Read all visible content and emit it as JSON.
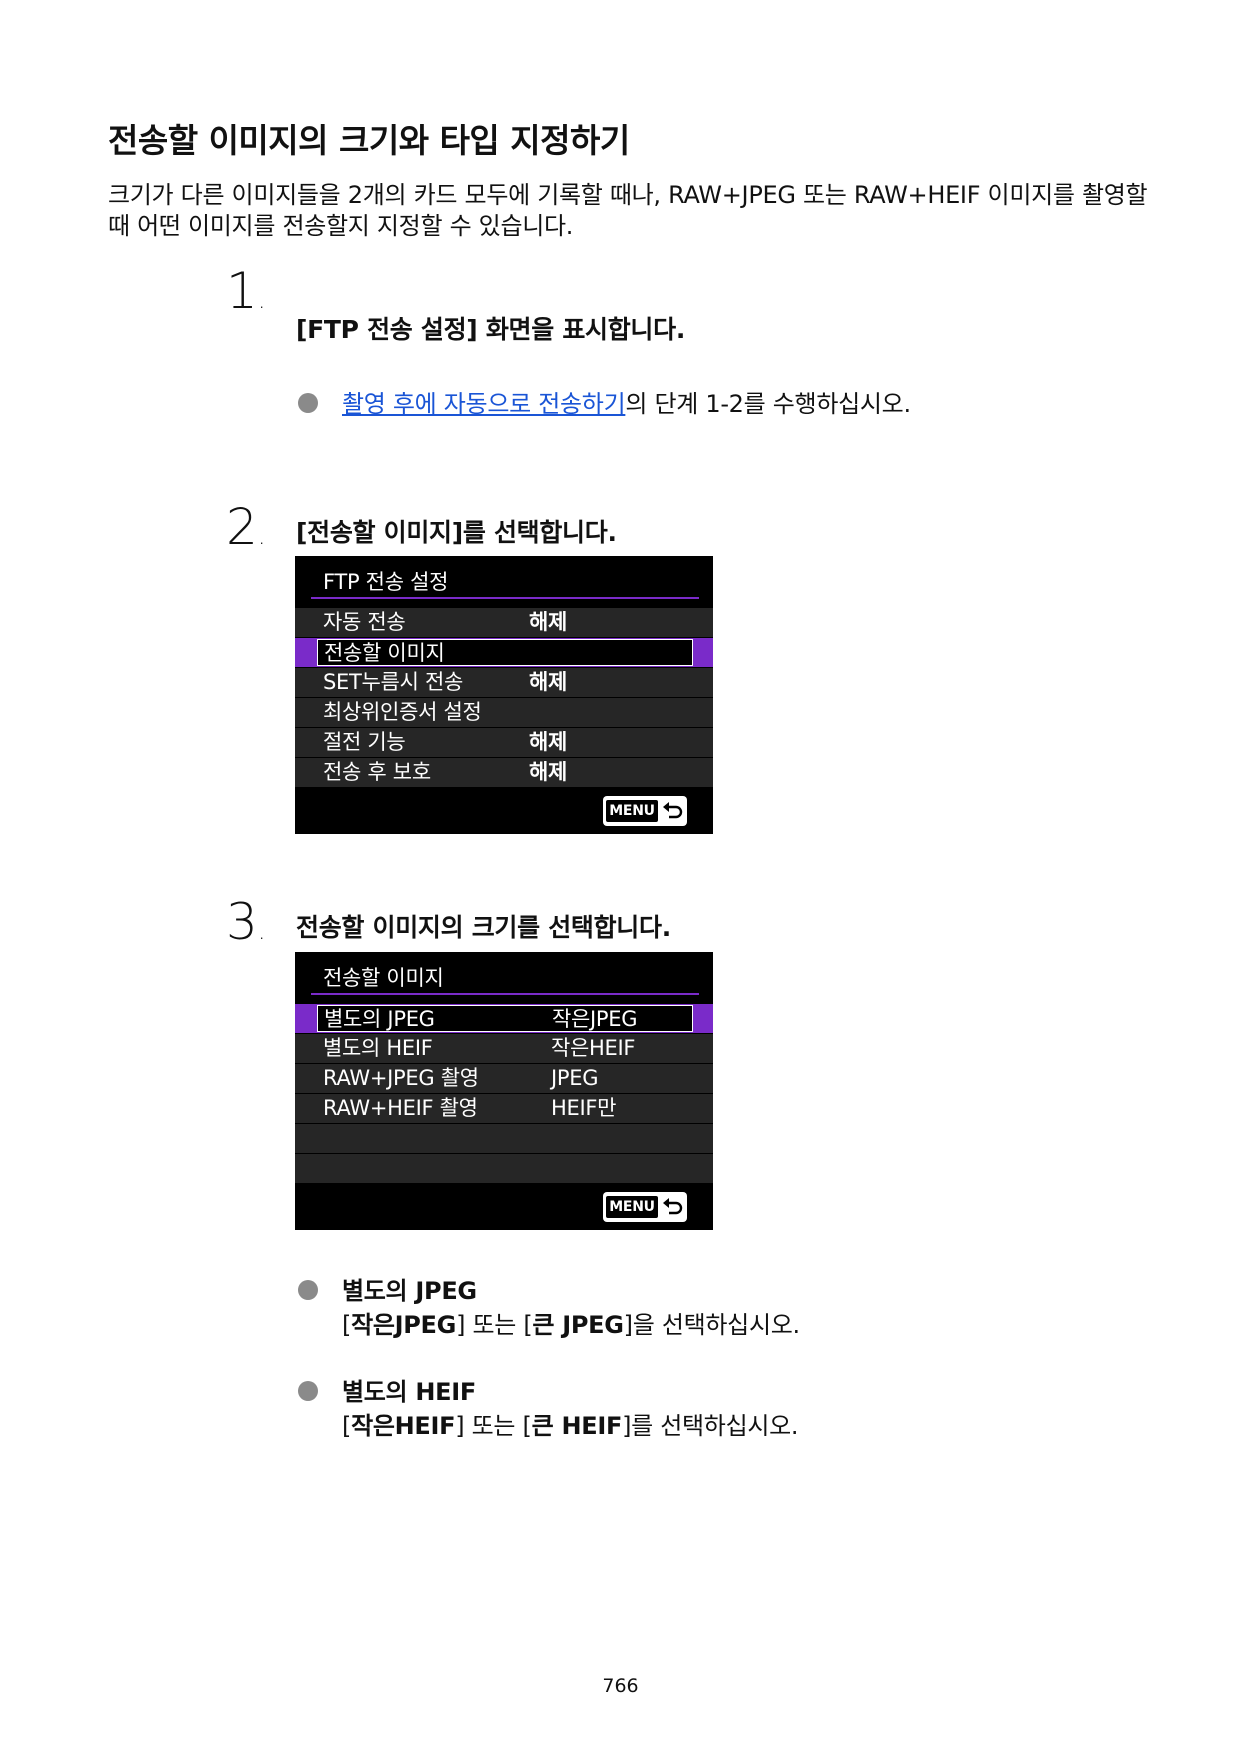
{
  "title": "전송할 이미지의 크기와 타입 지정하기",
  "intro": "크기가 다른 이미지들을 2개의 카드 모두에 기록할 때나, RAW+JPEG 또는 RAW+HEIF 이미지를 촬영할 때 어떤 이미지를 전송할지 지정할 수 있습니다.",
  "steps": [
    {
      "number": "1",
      "dot": ".",
      "title": "[FTP 전송 설정] 화면을 표시합니다.",
      "bullet_link": "촬영 후에 자동으로 전송하기",
      "bullet_rest": "의 단계 1-2를 수행하십시오."
    },
    {
      "number": "2",
      "dot": ".",
      "title": "[전송할 이미지]를 선택합니다."
    },
    {
      "number": "3",
      "dot": ".",
      "title": "전송할 이미지의 크기를 선택합니다."
    }
  ],
  "screen1": {
    "title": "FTP 전송 설정",
    "rows": [
      {
        "label": "자동 전송",
        "value": "해제"
      },
      {
        "label": "전송할 이미지",
        "value": ""
      },
      {
        "label": "SET누름시 전송",
        "value": "해제"
      },
      {
        "label": "최상위인증서 설정",
        "value": ""
      },
      {
        "label": "절전 기능",
        "value": "해제"
      },
      {
        "label": "전송 후 보호",
        "value": "해제"
      }
    ],
    "menu_button": "MENU"
  },
  "screen2": {
    "title": "전송할 이미지",
    "rows": [
      {
        "label": "별도의 JPEG",
        "value": "작은JPEG"
      },
      {
        "label": "별도의 HEIF",
        "value": "작은HEIF"
      },
      {
        "label": "RAW+JPEG 촬영",
        "value": "JPEG"
      },
      {
        "label": "RAW+HEIF 촬영",
        "value": "HEIF만"
      }
    ],
    "menu_button": "MENU"
  },
  "options": [
    {
      "heading": "별도의 JPEG",
      "open1": "[",
      "choice1": "작은JPEG",
      "mid": "] 또는 [",
      "choice2": "큰 JPEG",
      "close": "]을 선택하십시오."
    },
    {
      "heading": "별도의 HEIF",
      "open1": "[",
      "choice1": "작은HEIF",
      "mid": "] 또는 [",
      "choice2": "큰 HEIF",
      "close": "]를 선택하십시오."
    }
  ],
  "page_number": "766",
  "colors": {
    "accent_purple": "#7a2bc9",
    "link_blue": "#1a55d6",
    "bullet_gray": "#8a8a8a"
  }
}
